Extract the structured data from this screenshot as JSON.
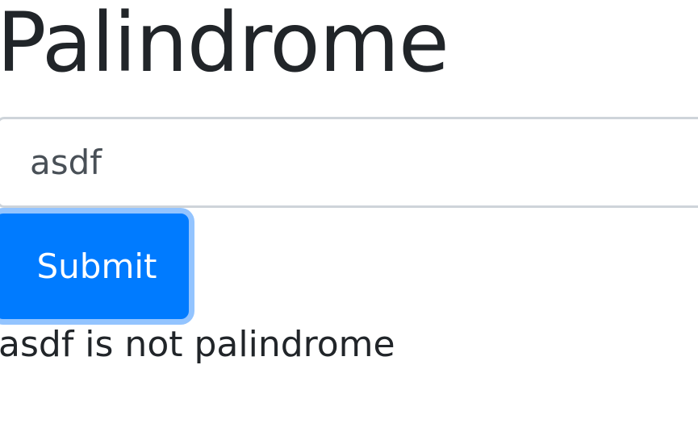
{
  "page": {
    "title": "Palindrome"
  },
  "form": {
    "input_value": "asdf",
    "submit_label": "Submit"
  },
  "result": {
    "message": "asdf is not palindrome"
  },
  "colors": {
    "primary": "#007bff",
    "focus_ring": "#93c4ff",
    "text": "#212529",
    "input_border": "#ced4da"
  }
}
